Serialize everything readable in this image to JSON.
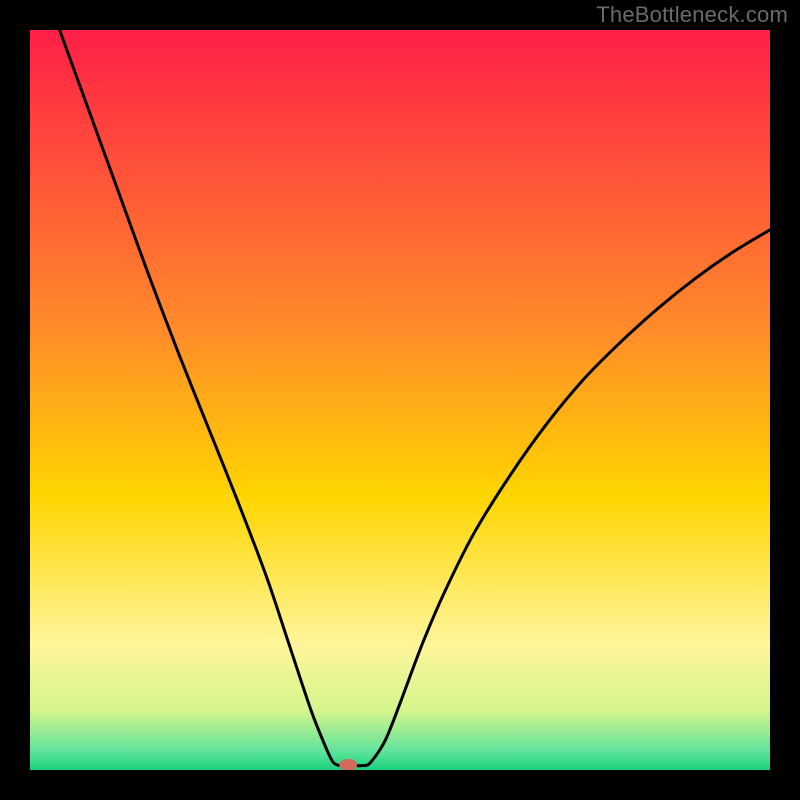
{
  "watermark": "TheBottleneck.com",
  "chart_data": {
    "type": "line",
    "title": "",
    "xlabel": "",
    "ylabel": "",
    "xlim": [
      0,
      100
    ],
    "ylim": [
      0,
      100
    ],
    "background_gradient": {
      "stops": [
        {
          "offset": 0.0,
          "color": "#ff1f47"
        },
        {
          "offset": 0.4,
          "color": "#ff8a2a"
        },
        {
          "offset": 0.63,
          "color": "#ffd500"
        },
        {
          "offset": 0.83,
          "color": "#fff59a"
        },
        {
          "offset": 0.92,
          "color": "#d4f58c"
        },
        {
          "offset": 0.975,
          "color": "#5ee39b"
        },
        {
          "offset": 1.0,
          "color": "#19d07d"
        }
      ]
    },
    "optimum_x": 43,
    "marker": {
      "x": 43,
      "y": 0.7,
      "color": "#d26a5a"
    },
    "curve_points": [
      {
        "x": 4,
        "y": 100
      },
      {
        "x": 8,
        "y": 89
      },
      {
        "x": 12,
        "y": 78
      },
      {
        "x": 16,
        "y": 67
      },
      {
        "x": 20,
        "y": 56.5
      },
      {
        "x": 24,
        "y": 46.5
      },
      {
        "x": 28,
        "y": 36.5
      },
      {
        "x": 32,
        "y": 26
      },
      {
        "x": 35,
        "y": 17
      },
      {
        "x": 38,
        "y": 8
      },
      {
        "x": 40,
        "y": 3
      },
      {
        "x": 41,
        "y": 1
      },
      {
        "x": 42,
        "y": 0.6
      },
      {
        "x": 43,
        "y": 0.6
      },
      {
        "x": 44,
        "y": 0.6
      },
      {
        "x": 45,
        "y": 0.6
      },
      {
        "x": 46,
        "y": 1
      },
      {
        "x": 48,
        "y": 4
      },
      {
        "x": 50,
        "y": 9
      },
      {
        "x": 53,
        "y": 17
      },
      {
        "x": 56,
        "y": 24
      },
      {
        "x": 60,
        "y": 32
      },
      {
        "x": 65,
        "y": 40
      },
      {
        "x": 70,
        "y": 47
      },
      {
        "x": 75,
        "y": 53
      },
      {
        "x": 80,
        "y": 58
      },
      {
        "x": 85,
        "y": 62.5
      },
      {
        "x": 90,
        "y": 66.5
      },
      {
        "x": 95,
        "y": 70
      },
      {
        "x": 100,
        "y": 73
      }
    ]
  }
}
